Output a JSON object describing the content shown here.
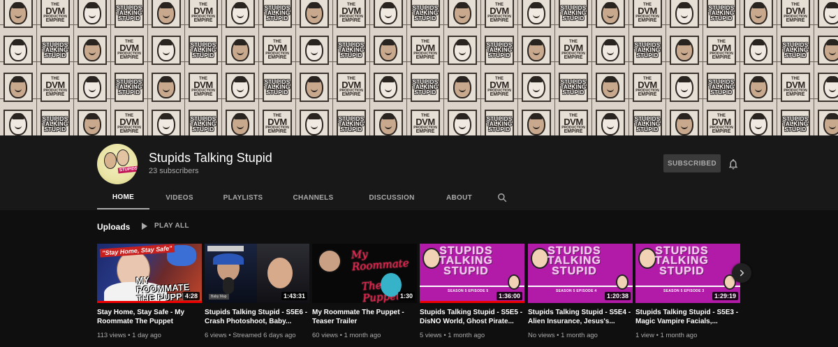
{
  "banner": {
    "dvm_logo": [
      "THE",
      "DVM",
      "PRODUCTION",
      "EMPIRE"
    ],
    "stupid_logo": [
      "STUPIDS",
      "TALKING",
      "STUPID"
    ]
  },
  "channel": {
    "name": "Stupids Talking Stupid",
    "subscribers": "23 subscribers",
    "subscribe_label": "SUBSCRIBED"
  },
  "tabs": [
    {
      "label": "HOME",
      "active": true
    },
    {
      "label": "VIDEOS",
      "active": false
    },
    {
      "label": "PLAYLISTS",
      "active": false
    },
    {
      "label": "CHANNELS",
      "active": false
    },
    {
      "label": "DISCUSSION",
      "active": false
    },
    {
      "label": "ABOUT",
      "active": false
    }
  ],
  "section": {
    "title": "Uploads",
    "play_all": "PLAY ALL"
  },
  "videos": [
    {
      "title": "Stay Home, Stay Safe - My Roommate The Puppet",
      "duration": "4:28",
      "meta": "113 views • 1 day ago",
      "thumb_text": [
        "\"Stay Home, Stay Safe\"",
        "MY ROOMMATE",
        "THE PUPPET"
      ],
      "watched": 1.0
    },
    {
      "title": "Stupids Talking Stupid - S5E6 - Crash Photoshoot, Baby...",
      "duration": "1:43:31",
      "meta": "6 views • Streamed 6 days ago",
      "thumb_text": [
        "Baby Map"
      ],
      "watched": 0.0
    },
    {
      "title": "My Roommate The Puppet - Teaser Trailer",
      "duration": "1:30",
      "meta": "60 views • 1 month ago",
      "thumb_text": [
        "My Roommate",
        "The Puppet"
      ],
      "watched": 0.0
    },
    {
      "title": "Stupids Talking Stupid - S5E5 - DisNO World, Ghost Pirate...",
      "duration": "1:36:00",
      "meta": "5 views • 1 month ago",
      "thumb_text": [
        "STUPIDS",
        "TALKING",
        "STUPID",
        "SEASON 5 EPISODE 5"
      ],
      "watched": 1.0
    },
    {
      "title": "Stupids Talking Stupid - S5E4 - Alien Insurance, Jesus's...",
      "duration": "1:20:38",
      "meta": "No views • 1 month ago",
      "thumb_text": [
        "STUPIDS",
        "TALKING",
        "STUPID",
        "SEASON 5 EPISODE 4"
      ],
      "watched": 0.0
    },
    {
      "title": "Stupids Talking Stupid - S5E3 - Magic Vampire Facials,...",
      "duration": "1:29:19",
      "meta": "1 view • 1 month ago",
      "thumb_text": [
        "STUPIDS",
        "TALKING",
        "STUPID",
        "SEASON 5 EPISODE 3"
      ],
      "watched": 0.0
    }
  ],
  "colors": {
    "background": "#181818",
    "content_bg": "#0f0f0f",
    "accent_red": "#ee0000",
    "thumb_magenta": "#b21ba8"
  },
  "icons": [
    "bell-icon",
    "search-icon",
    "play-icon",
    "chevron-right-icon"
  ]
}
